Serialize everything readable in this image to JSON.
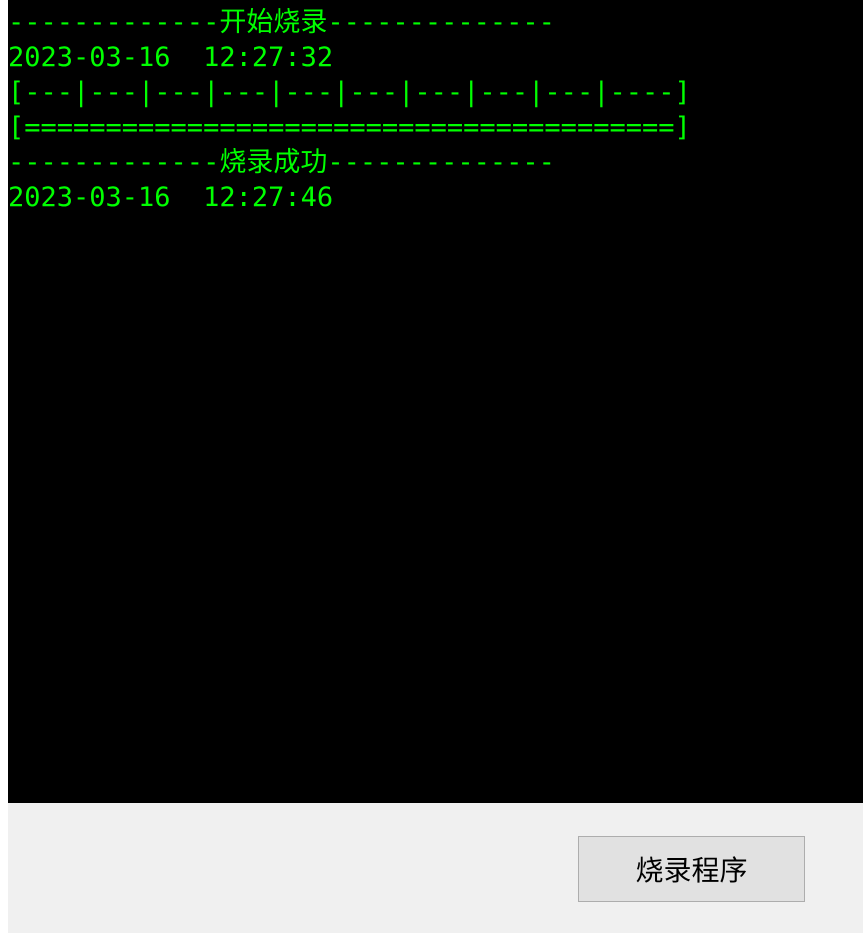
{
  "console": {
    "lines": [
      "-------------开始烧录--------------",
      "2023-03-16  12:27:32",
      "[---|---|---|---|---|---|---|---|---|----]",
      "[========================================]",
      "-------------烧录成功--------------",
      "2023-03-16  12:27:46"
    ]
  },
  "toolbar": {
    "burn_button_label": "烧录程序"
  },
  "colors": {
    "console_bg": "#000000",
    "console_text": "#00ff00",
    "panel_bg": "#f0f0f0",
    "button_bg": "#e1e1e1"
  }
}
